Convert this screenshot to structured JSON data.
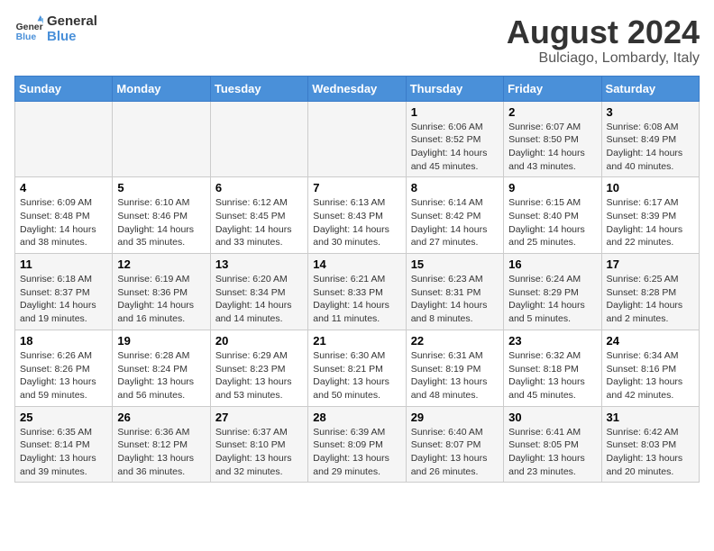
{
  "logo": {
    "line1": "General",
    "line2": "Blue"
  },
  "title": "August 2024",
  "subtitle": "Bulciago, Lombardy, Italy",
  "days_of_week": [
    "Sunday",
    "Monday",
    "Tuesday",
    "Wednesday",
    "Thursday",
    "Friday",
    "Saturday"
  ],
  "weeks": [
    [
      {
        "day": "",
        "info": ""
      },
      {
        "day": "",
        "info": ""
      },
      {
        "day": "",
        "info": ""
      },
      {
        "day": "",
        "info": ""
      },
      {
        "day": "1",
        "info": "Sunrise: 6:06 AM\nSunset: 8:52 PM\nDaylight: 14 hours and 45 minutes."
      },
      {
        "day": "2",
        "info": "Sunrise: 6:07 AM\nSunset: 8:50 PM\nDaylight: 14 hours and 43 minutes."
      },
      {
        "day": "3",
        "info": "Sunrise: 6:08 AM\nSunset: 8:49 PM\nDaylight: 14 hours and 40 minutes."
      }
    ],
    [
      {
        "day": "4",
        "info": "Sunrise: 6:09 AM\nSunset: 8:48 PM\nDaylight: 14 hours and 38 minutes."
      },
      {
        "day": "5",
        "info": "Sunrise: 6:10 AM\nSunset: 8:46 PM\nDaylight: 14 hours and 35 minutes."
      },
      {
        "day": "6",
        "info": "Sunrise: 6:12 AM\nSunset: 8:45 PM\nDaylight: 14 hours and 33 minutes."
      },
      {
        "day": "7",
        "info": "Sunrise: 6:13 AM\nSunset: 8:43 PM\nDaylight: 14 hours and 30 minutes."
      },
      {
        "day": "8",
        "info": "Sunrise: 6:14 AM\nSunset: 8:42 PM\nDaylight: 14 hours and 27 minutes."
      },
      {
        "day": "9",
        "info": "Sunrise: 6:15 AM\nSunset: 8:40 PM\nDaylight: 14 hours and 25 minutes."
      },
      {
        "day": "10",
        "info": "Sunrise: 6:17 AM\nSunset: 8:39 PM\nDaylight: 14 hours and 22 minutes."
      }
    ],
    [
      {
        "day": "11",
        "info": "Sunrise: 6:18 AM\nSunset: 8:37 PM\nDaylight: 14 hours and 19 minutes."
      },
      {
        "day": "12",
        "info": "Sunrise: 6:19 AM\nSunset: 8:36 PM\nDaylight: 14 hours and 16 minutes."
      },
      {
        "day": "13",
        "info": "Sunrise: 6:20 AM\nSunset: 8:34 PM\nDaylight: 14 hours and 14 minutes."
      },
      {
        "day": "14",
        "info": "Sunrise: 6:21 AM\nSunset: 8:33 PM\nDaylight: 14 hours and 11 minutes."
      },
      {
        "day": "15",
        "info": "Sunrise: 6:23 AM\nSunset: 8:31 PM\nDaylight: 14 hours and 8 minutes."
      },
      {
        "day": "16",
        "info": "Sunrise: 6:24 AM\nSunset: 8:29 PM\nDaylight: 14 hours and 5 minutes."
      },
      {
        "day": "17",
        "info": "Sunrise: 6:25 AM\nSunset: 8:28 PM\nDaylight: 14 hours and 2 minutes."
      }
    ],
    [
      {
        "day": "18",
        "info": "Sunrise: 6:26 AM\nSunset: 8:26 PM\nDaylight: 13 hours and 59 minutes."
      },
      {
        "day": "19",
        "info": "Sunrise: 6:28 AM\nSunset: 8:24 PM\nDaylight: 13 hours and 56 minutes."
      },
      {
        "day": "20",
        "info": "Sunrise: 6:29 AM\nSunset: 8:23 PM\nDaylight: 13 hours and 53 minutes."
      },
      {
        "day": "21",
        "info": "Sunrise: 6:30 AM\nSunset: 8:21 PM\nDaylight: 13 hours and 50 minutes."
      },
      {
        "day": "22",
        "info": "Sunrise: 6:31 AM\nSunset: 8:19 PM\nDaylight: 13 hours and 48 minutes."
      },
      {
        "day": "23",
        "info": "Sunrise: 6:32 AM\nSunset: 8:18 PM\nDaylight: 13 hours and 45 minutes."
      },
      {
        "day": "24",
        "info": "Sunrise: 6:34 AM\nSunset: 8:16 PM\nDaylight: 13 hours and 42 minutes."
      }
    ],
    [
      {
        "day": "25",
        "info": "Sunrise: 6:35 AM\nSunset: 8:14 PM\nDaylight: 13 hours and 39 minutes."
      },
      {
        "day": "26",
        "info": "Sunrise: 6:36 AM\nSunset: 8:12 PM\nDaylight: 13 hours and 36 minutes."
      },
      {
        "day": "27",
        "info": "Sunrise: 6:37 AM\nSunset: 8:10 PM\nDaylight: 13 hours and 32 minutes."
      },
      {
        "day": "28",
        "info": "Sunrise: 6:39 AM\nSunset: 8:09 PM\nDaylight: 13 hours and 29 minutes."
      },
      {
        "day": "29",
        "info": "Sunrise: 6:40 AM\nSunset: 8:07 PM\nDaylight: 13 hours and 26 minutes."
      },
      {
        "day": "30",
        "info": "Sunrise: 6:41 AM\nSunset: 8:05 PM\nDaylight: 13 hours and 23 minutes."
      },
      {
        "day": "31",
        "info": "Sunrise: 6:42 AM\nSunset: 8:03 PM\nDaylight: 13 hours and 20 minutes."
      }
    ]
  ]
}
